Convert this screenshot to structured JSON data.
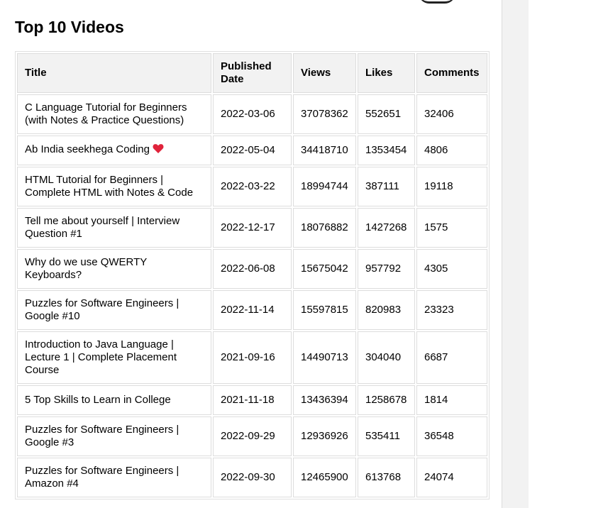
{
  "section_title": "Top 10 Videos",
  "table": {
    "headers": {
      "title": "Title",
      "published_date": "Published Date",
      "views": "Views",
      "likes": "Likes",
      "comments": "Comments"
    },
    "rows": [
      {
        "title": "C Language Tutorial for Beginners (with Notes & Practice Questions)",
        "date": "2022-03-06",
        "views": "37078362",
        "likes": "552651",
        "comments": "32406"
      },
      {
        "title": "Ab India seekhega Coding",
        "emoji": "heart-icon",
        "date": "2022-05-04",
        "views": "34418710",
        "likes": "1353454",
        "comments": "4806"
      },
      {
        "title": "HTML Tutorial for Beginners | Complete HTML with Notes & Code",
        "date": "2022-03-22",
        "views": "18994744",
        "likes": "387111",
        "comments": "19118"
      },
      {
        "title": "Tell me about yourself | Interview Question #1",
        "date": "2022-12-17",
        "views": "18076882",
        "likes": "1427268",
        "comments": "1575"
      },
      {
        "title": "Why do we use QWERTY Keyboards?",
        "date": "2022-06-08",
        "views": "15675042",
        "likes": "957792",
        "comments": "4305"
      },
      {
        "title": "Puzzles for Software Engineers | Google #10",
        "date": "2022-11-14",
        "views": "15597815",
        "likes": "820983",
        "comments": "23323"
      },
      {
        "title": "Introduction to Java Language | Lecture 1 | Complete Placement Course",
        "date": "2021-09-16",
        "views": "14490713",
        "likes": "304040",
        "comments": "6687"
      },
      {
        "title": "5 Top Skills to Learn in College",
        "date": "2021-11-18",
        "views": "13436394",
        "likes": "1258678",
        "comments": "1814"
      },
      {
        "title": "Puzzles for Software Engineers | Google #3",
        "date": "2022-09-29",
        "views": "12936926",
        "likes": "535411",
        "comments": "36548"
      },
      {
        "title": "Puzzles for Software Engineers | Amazon #4",
        "date": "2022-09-30",
        "views": "12465900",
        "likes": "613768",
        "comments": "24074"
      }
    ]
  },
  "colors": {
    "header_bg": "#f2f2f2",
    "heart": "#e0233b",
    "cell_border": "#dddddd"
  }
}
